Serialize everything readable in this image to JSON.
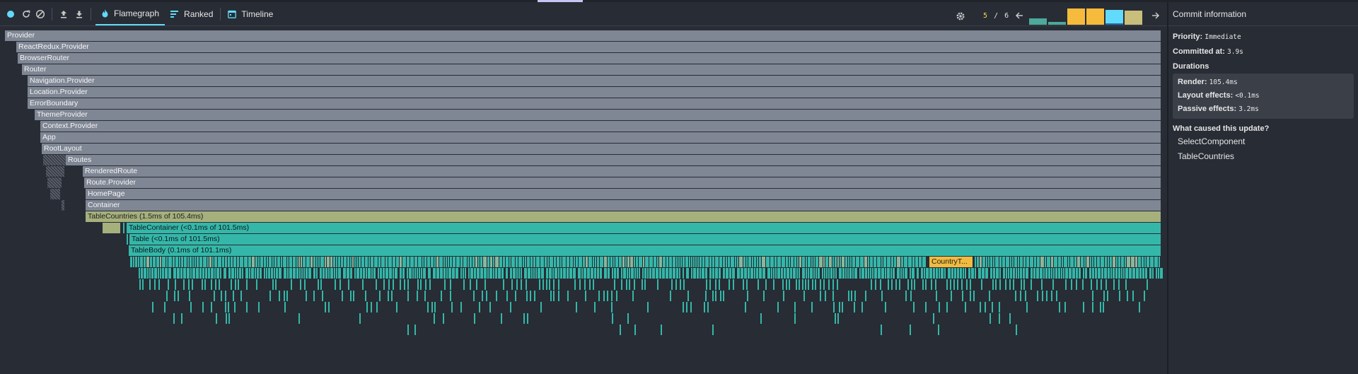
{
  "toolbar": {
    "icons": {
      "record": "record-dot-icon",
      "reload": "reload-icon",
      "clear": "clear-icon",
      "load": "load-profile-icon",
      "save": "save-profile-icon"
    },
    "tabs": [
      {
        "label": "Flamegraph",
        "icon": "flame-icon",
        "active": true
      },
      {
        "label": "Ranked",
        "icon": "ranked-bars-icon",
        "active": false
      },
      {
        "label": "Timeline",
        "icon": "timeline-icon",
        "active": false
      }
    ],
    "settings_icon": "gear-icon",
    "commit_current": "5",
    "commit_separator": "/",
    "commit_total": "6",
    "commits": [
      {
        "duration_fraction": 0.36,
        "color": "#4ca99b"
      },
      {
        "duration_fraction": 0.16,
        "color": "#4ca99b"
      },
      {
        "duration_fraction": 0.92,
        "color": "#f6bb3d"
      },
      {
        "duration_fraction": 0.92,
        "color": "#f6bb3d"
      },
      {
        "duration_fraction": 0.84,
        "color": "#61dafb",
        "selected": true
      },
      {
        "duration_fraction": 0.8,
        "color": "#c9be7c"
      }
    ]
  },
  "flamegraph": {
    "rows": [
      {
        "bars": [
          {
            "label": "Provider",
            "color": "gray"
          }
        ]
      },
      {
        "bars": [
          {
            "label": "ReactRedux.Provider",
            "color": "gray"
          }
        ]
      },
      {
        "bars": [
          {
            "label": "BrowserRouter",
            "color": "gray"
          }
        ]
      },
      {
        "bars": [
          {
            "label": "Router",
            "color": "gray"
          }
        ]
      },
      {
        "bars": [
          {
            "label": "Navigation.Provider",
            "color": "gray"
          }
        ]
      },
      {
        "bars": [
          {
            "label": "Location.Provider",
            "color": "gray"
          }
        ]
      },
      {
        "bars": [
          {
            "label": "ErrorBoundary",
            "color": "gray"
          }
        ]
      },
      {
        "bars": [
          {
            "label": "ThemeProvider",
            "color": "gray"
          }
        ]
      },
      {
        "bars": [
          {
            "label": "Context.Provider",
            "color": "gray"
          }
        ]
      },
      {
        "bars": [
          {
            "label": "App",
            "color": "gray"
          }
        ]
      },
      {
        "bars": [
          {
            "label": "RootLayout",
            "color": "gray"
          }
        ]
      },
      {
        "bars": [
          {
            "label": "Routes",
            "color": "gray"
          }
        ]
      },
      {
        "bars": [
          {
            "label": "RenderedRoute",
            "color": "gray"
          }
        ]
      },
      {
        "bars": [
          {
            "label": "Route.Provider",
            "color": "gray"
          }
        ]
      },
      {
        "bars": [
          {
            "label": "HomePage",
            "color": "gray"
          }
        ]
      },
      {
        "bars": [
          {
            "label": "Container",
            "color": "gray"
          }
        ]
      },
      {
        "bars": [
          {
            "label": "TableCountries (1.5ms of 105.4ms)",
            "color": "yellow"
          }
        ]
      },
      {
        "bars": [
          {
            "label": "TableContainer (<0.1ms of 101.5ms)",
            "color": "teal"
          }
        ]
      },
      {
        "bars": [
          {
            "label": "Table (<0.1ms of 101.5ms)",
            "color": "teal"
          }
        ]
      },
      {
        "bars": [
          {
            "label": "TableBody (0.1ms of 101.1ms)",
            "color": "teal"
          }
        ]
      },
      {
        "bars": [
          {
            "label": "CountryT...",
            "color": "orange"
          }
        ]
      }
    ]
  },
  "sidebar": {
    "title": "Commit information",
    "priority_label": "Priority:",
    "priority_value": "Immediate",
    "committed_label": "Committed at:",
    "committed_value": "3.9s",
    "durations_label": "Durations",
    "render_label": "Render:",
    "render_value": "105.4ms",
    "layout_label": "Layout effects:",
    "layout_value": "<0.1ms",
    "passive_label": "Passive effects:",
    "passive_value": "3.2ms",
    "cause_label": "What caused this update?",
    "causes": [
      "SelectComponent",
      "TableCountries"
    ]
  }
}
